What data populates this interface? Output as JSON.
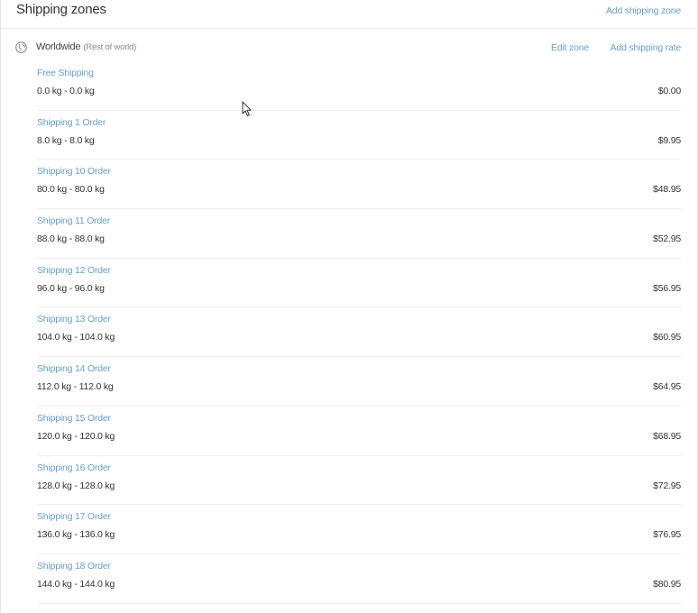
{
  "header": {
    "title": "Shipping zones",
    "add_zone_label": "Add shipping zone"
  },
  "zone": {
    "icon": "globe-icon",
    "name": "Worldwide",
    "subtitle": "(Rest of world)",
    "edit_label": "Edit zone",
    "add_rate_label": "Add shipping rate"
  },
  "rates": [
    {
      "name": "Free Shipping",
      "range": "0.0 kg - 0.0 kg",
      "price": "$0.00"
    },
    {
      "name": "Shipping 1 Order",
      "range": "8.0 kg - 8.0 kg",
      "price": "$9.95"
    },
    {
      "name": "Shipping 10 Order",
      "range": "80.0 kg - 80.0 kg",
      "price": "$48.95"
    },
    {
      "name": "Shipping 11 Order",
      "range": "88.0 kg - 88.0 kg",
      "price": "$52.95"
    },
    {
      "name": "Shipping 12 Order",
      "range": "96.0 kg - 96.0 kg",
      "price": "$56.95"
    },
    {
      "name": "Shipping 13 Order",
      "range": "104.0 kg - 104.0 kg",
      "price": "$60.95"
    },
    {
      "name": "Shipping 14 Order",
      "range": "112.0 kg - 112.0 kg",
      "price": "$64.95"
    },
    {
      "name": "Shipping 15 Order",
      "range": "120.0 kg - 120.0 kg",
      "price": "$68.95"
    },
    {
      "name": "Shipping 16 Order",
      "range": "128.0 kg - 128.0 kg",
      "price": "$72.95"
    },
    {
      "name": "Shipping 17 Order",
      "range": "136.0 kg - 136.0 kg",
      "price": "$76.95"
    },
    {
      "name": "Shipping 18 Order",
      "range": "144.0 kg - 144.0 kg",
      "price": "$80.95"
    }
  ],
  "colors": {
    "link": "#6a9ec9",
    "text": "#333333",
    "muted": "#888888",
    "divider": "#f0f0f0"
  }
}
